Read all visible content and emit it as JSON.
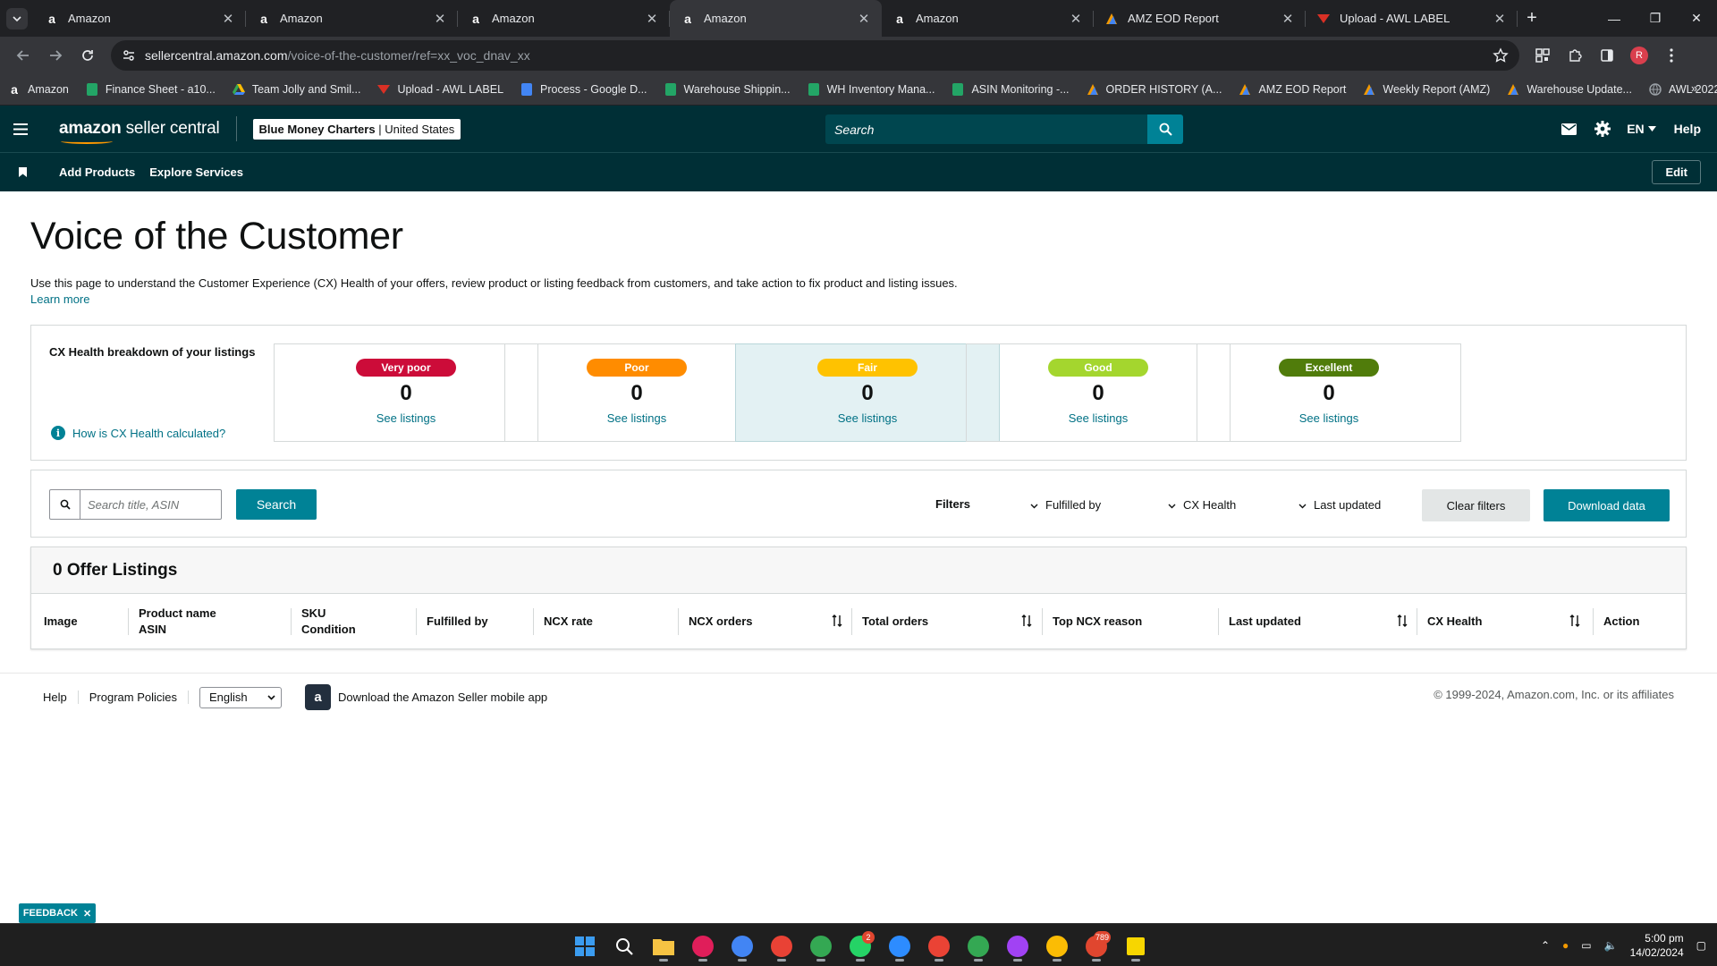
{
  "browser": {
    "tabs": [
      {
        "title": "Amazon",
        "icon": "amazon-a-icon",
        "active": false
      },
      {
        "title": "Amazon",
        "icon": "amazon-a-icon",
        "active": false
      },
      {
        "title": "Amazon",
        "icon": "amazon-a-icon",
        "active": false
      },
      {
        "title": "Amazon",
        "icon": "amazon-a-icon",
        "active": true
      },
      {
        "title": "Amazon",
        "icon": "amazon-a-icon",
        "active": false
      },
      {
        "title": "AMZ EOD Report",
        "icon": "report-icon",
        "active": false
      },
      {
        "title": "Upload - AWL LABEL",
        "icon": "awl-icon",
        "active": false
      }
    ],
    "url_host": "sellercentral.amazon.com",
    "url_path": "/voice-of-the-customer/ref=xx_voc_dnav_xx",
    "profile_initial": "R",
    "bookmarks": [
      {
        "label": "Amazon",
        "icon": "amazon-a-icon",
        "color": "#ffffff"
      },
      {
        "label": "Finance Sheet - a10...",
        "icon": "sheets-icon",
        "color": "#23a566"
      },
      {
        "label": "Team Jolly and Smil...",
        "icon": "drive-icon",
        "color": "#fbbc04"
      },
      {
        "label": "Upload - AWL LABEL",
        "icon": "awl-icon",
        "color": "#d93025"
      },
      {
        "label": "Process - Google D...",
        "icon": "docs-icon",
        "color": "#4285f4"
      },
      {
        "label": "Warehouse Shippin...",
        "icon": "sheets-icon",
        "color": "#23a566"
      },
      {
        "label": "WH Inventory Mana...",
        "icon": "sheets-icon",
        "color": "#23a566"
      },
      {
        "label": "ASIN Monitoring -...",
        "icon": "sheets-icon",
        "color": "#23a566"
      },
      {
        "label": "ORDER HISTORY (A...",
        "icon": "report-icon",
        "color": "#f29900"
      },
      {
        "label": "AMZ EOD Report",
        "icon": "report-icon",
        "color": "#f29900"
      },
      {
        "label": "Weekly Report (AMZ)",
        "icon": "report-icon",
        "color": "#f29900"
      },
      {
        "label": "Warehouse Update...",
        "icon": "report-icon",
        "color": "#f29900"
      },
      {
        "label": "AWL 2022",
        "icon": "globe-icon",
        "color": "#9aa0a6"
      }
    ]
  },
  "header": {
    "logo_bold": "amazon",
    "logo_rest": " seller central",
    "account_name": "Blue Money Charters",
    "account_region": "United States",
    "search_placeholder": "Search",
    "language": "EN",
    "help": "Help"
  },
  "subnav": {
    "links": [
      "Add Products",
      "Explore Services"
    ],
    "edit": "Edit"
  },
  "page": {
    "title": "Voice of the Customer",
    "description": "Use this page to understand the Customer Experience (CX) Health of your offers, review product or listing feedback from customers, and take action to fix product and listing issues.",
    "learn_more": "Learn more"
  },
  "cx_health": {
    "label": "CX Health breakdown of your listings",
    "how_link": "How is CX Health calculated?",
    "cards": [
      {
        "label": "Very poor",
        "count": "0",
        "link": "See listings",
        "color": "#cc0c39",
        "text_color": "#ffffff",
        "selected": false
      },
      {
        "label": "Poor",
        "count": "0",
        "link": "See listings",
        "color": "#ff8c00",
        "text_color": "#ffffff",
        "selected": false
      },
      {
        "label": "Fair",
        "count": "0",
        "link": "See listings",
        "color": "#ffc200",
        "text_color": "#ffffff",
        "selected": true
      },
      {
        "label": "Good",
        "count": "0",
        "link": "See listings",
        "color": "#a4d62e",
        "text_color": "#ffffff",
        "selected": false
      },
      {
        "label": "Excellent",
        "count": "0",
        "link": "See listings",
        "color": "#507c0b",
        "text_color": "#ffffff",
        "selected": false
      }
    ]
  },
  "filters": {
    "search_placeholder": "Search title, ASIN",
    "search_button": "Search",
    "title": "Filters",
    "dropdowns": [
      "Fulfilled by",
      "CX Health",
      "Last updated"
    ],
    "clear": "Clear filters",
    "download": "Download data"
  },
  "listings": {
    "title": "0 Offer Listings",
    "columns": [
      {
        "line1": "Image",
        "line2": "",
        "sortable": false
      },
      {
        "line1": "Product name",
        "line2": "ASIN",
        "sortable": false
      },
      {
        "line1": "SKU",
        "line2": "Condition",
        "sortable": false
      },
      {
        "line1": "Fulfilled by",
        "line2": "",
        "sortable": false
      },
      {
        "line1": "NCX rate",
        "line2": "",
        "sortable": false
      },
      {
        "line1": "NCX orders",
        "line2": "",
        "sortable": true
      },
      {
        "line1": "Total orders",
        "line2": "",
        "sortable": true
      },
      {
        "line1": "Top NCX reason",
        "line2": "",
        "sortable": false
      },
      {
        "line1": "Last updated",
        "line2": "",
        "sortable": true
      },
      {
        "line1": "CX Health",
        "line2": "",
        "sortable": true
      },
      {
        "line1": "Action",
        "line2": "",
        "sortable": false
      }
    ]
  },
  "footer": {
    "links": [
      "Help",
      "Program Policies"
    ],
    "language_select": "English",
    "app_download": "Download the Amazon Seller mobile app",
    "copyright": "© 1999-2024, Amazon.com, Inc. or its affiliates"
  },
  "feedback": "FEEDBACK",
  "taskbar": {
    "apps": [
      {
        "icon": "windows-start-icon",
        "color": "#3b9cf0",
        "badge": ""
      },
      {
        "icon": "search-icon",
        "color": "#ffffff",
        "badge": ""
      },
      {
        "icon": "file-explorer-icon",
        "color": "#f6c343",
        "badge": ""
      },
      {
        "icon": "slack-icon",
        "color": "#e01e5a",
        "badge": ""
      },
      {
        "icon": "chrome-icon",
        "color": "#4285f4",
        "badge": ""
      },
      {
        "icon": "chrome-icon",
        "color": "#e94235",
        "badge": ""
      },
      {
        "icon": "chrome-icon",
        "color": "#34a853",
        "badge": ""
      },
      {
        "icon": "whatsapp-icon",
        "color": "#25d366",
        "badge": "2"
      },
      {
        "icon": "zoom-icon",
        "color": "#2d8cff",
        "badge": ""
      },
      {
        "icon": "chrome-icon",
        "color": "#ea4335",
        "badge": ""
      },
      {
        "icon": "chrome-icon",
        "color": "#34a853",
        "badge": ""
      },
      {
        "icon": "chrome-icon",
        "color": "#a142f4",
        "badge": ""
      },
      {
        "icon": "chrome-icon",
        "color": "#fbbc04",
        "badge": ""
      },
      {
        "icon": "telegram-icon",
        "color": "#e0462f",
        "badge": "789"
      },
      {
        "icon": "sticky-notes-icon",
        "color": "#f7d600",
        "badge": ""
      }
    ],
    "time": "5:00 pm",
    "date": "14/02/2024"
  }
}
